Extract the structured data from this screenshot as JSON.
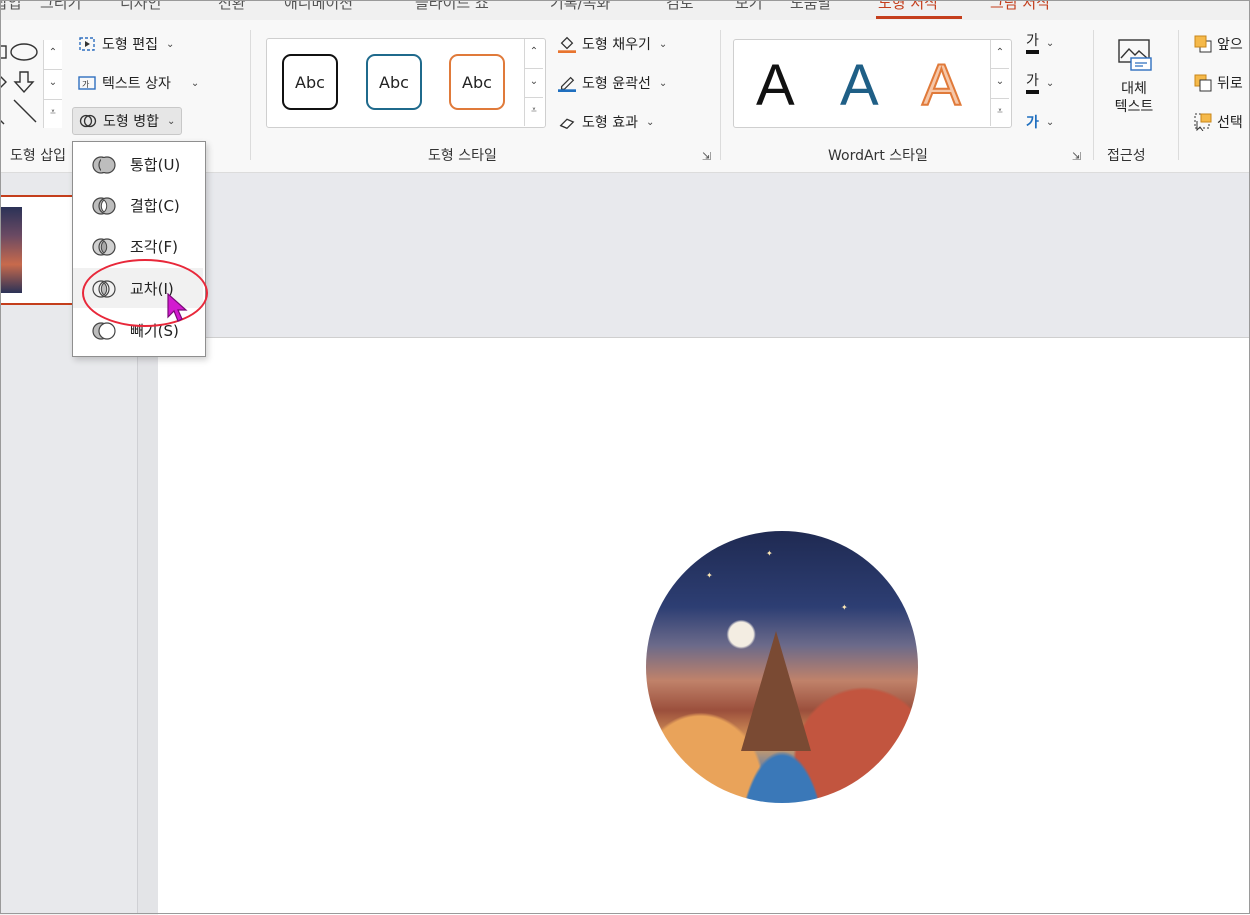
{
  "menu": {
    "tabs": [
      "삽입",
      "그리기",
      "디자인",
      "전환",
      "애니메이션",
      "슬라이드 쇼",
      "기록/녹화",
      "검토",
      "보기",
      "도움말",
      "도형 서식",
      "그림 서식"
    ],
    "active_tab": "도형 서식",
    "picture_tab": "그림 서식"
  },
  "ribbon": {
    "insert_shapes": {
      "label": "도형 삽입"
    },
    "edit_shape": "도형 편집",
    "text_box": "텍스트 상자",
    "merge_shapes": "도형 병합",
    "shape_styles": {
      "label": "도형 스타일",
      "presets": [
        "Abc",
        "Abc",
        "Abc"
      ]
    },
    "shape_fill": "도형 채우기",
    "shape_outline": "도형 윤곽선",
    "shape_effects": "도형 효과",
    "wordart": {
      "label": "WordArt 스타일",
      "letters": [
        "A",
        "A",
        "A"
      ],
      "text_glyph": "가",
      "outline_glyph": "가",
      "effect_glyph": "가"
    },
    "alt_text": {
      "line1": "대체",
      "line2": "텍스트",
      "group": "접근성"
    },
    "arrange": {
      "bring_forward": "앞으",
      "send_backward": "뒤로",
      "selection": "선택"
    }
  },
  "merge_menu": {
    "items": [
      {
        "label": "통합(U)",
        "key": "union"
      },
      {
        "label": "결합(C)",
        "key": "combine"
      },
      {
        "label": "조각(F)",
        "key": "fragment"
      },
      {
        "label": "교차(I)",
        "key": "intersect"
      },
      {
        "label": "빼기(S)",
        "key": "subtract"
      }
    ],
    "hovered": "intersect"
  },
  "colors": {
    "accent": "#c43e1c",
    "ring": "#e8283a",
    "cursor": "#d21bd0"
  }
}
